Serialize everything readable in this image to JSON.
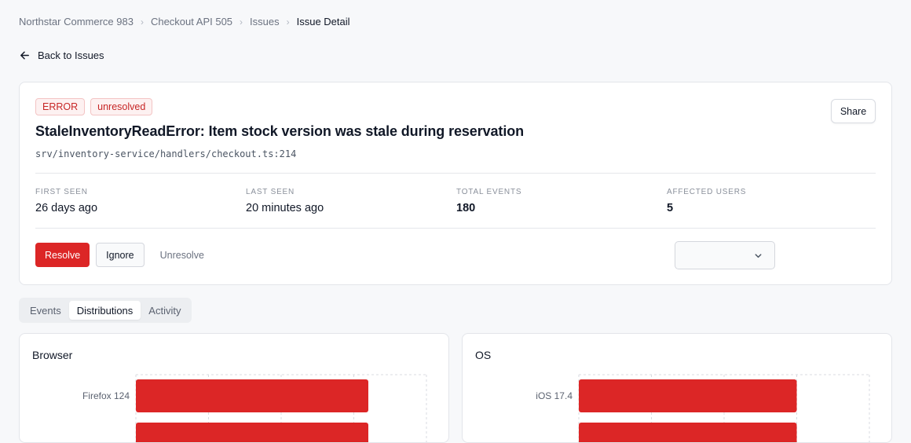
{
  "breadcrumb": {
    "items": [
      "Northstar Commerce 983",
      "Checkout API 505",
      "Issues"
    ],
    "current": "Issue Detail"
  },
  "back_link": "Back to Issues",
  "issue": {
    "level_badge": "ERROR",
    "status_badge": "unresolved",
    "title": "StaleInventoryReadError: Item stock version was stale during reservation",
    "path": "srv/inventory-service/handlers/checkout.ts:214",
    "share_label": "Share"
  },
  "stats": {
    "first_seen_label": "First seen",
    "first_seen": "26 days ago",
    "last_seen_label": "Last seen",
    "last_seen": "20 minutes ago",
    "total_events_label": "Total events",
    "total_events": "180",
    "affected_users_label": "Affected users",
    "affected_users": "5"
  },
  "actions": {
    "resolve": "Resolve",
    "ignore": "Ignore",
    "unresolve": "Unresolve",
    "assignee_value": ""
  },
  "tabs": [
    "Events",
    "Distributions",
    "Activity"
  ],
  "active_tab": "Distributions",
  "colors": {
    "accent": "#dc2626",
    "badge_text": "#c72626"
  },
  "icons": {
    "back": "arrow-left-icon",
    "select": "chevron-down-icon"
  },
  "chart_data": [
    {
      "type": "bar",
      "orientation": "horizontal",
      "title": "Browser",
      "categories": [
        "Firefox 124"
      ],
      "values": [
        0.8
      ],
      "xlim": [
        0,
        1
      ],
      "grid": true,
      "partial": true
    },
    {
      "type": "bar",
      "orientation": "horizontal",
      "title": "OS",
      "categories": [
        "iOS 17.4"
      ],
      "values": [
        0.75
      ],
      "xlim": [
        0,
        1
      ],
      "grid": true,
      "partial": true
    }
  ]
}
